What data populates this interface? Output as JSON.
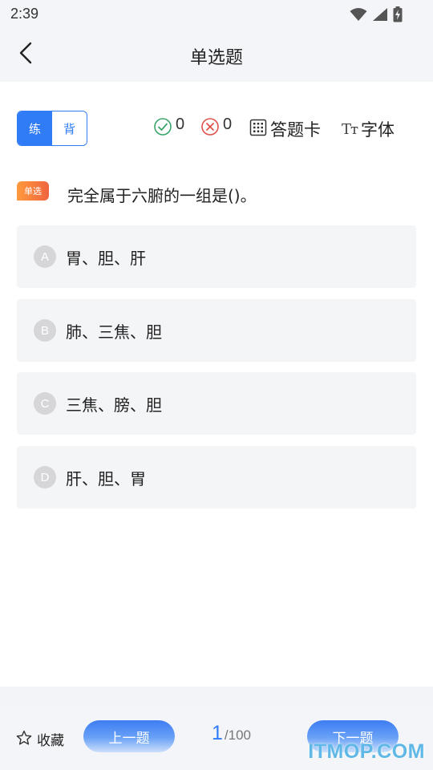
{
  "status_bar": {
    "time": "2:39",
    "icons": [
      "wifi-icon",
      "cellular-signal-icon",
      "battery-charging-icon"
    ]
  },
  "app_bar": {
    "title": "单选题",
    "back_icon": "chevron-left-icon"
  },
  "mode_toggle": {
    "practice_label": "练",
    "recite_label": "背",
    "active": "practice"
  },
  "toolbar": {
    "correct_count": "0",
    "wrong_count": "0",
    "answer_card_label": "答题卡",
    "font_glyph": "Tт",
    "font_label": "字体"
  },
  "question": {
    "type_tag": "单选",
    "text": "完全属于六腑的一组是()。",
    "options": [
      {
        "letter": "A",
        "text": "胃、胆、肝"
      },
      {
        "letter": "B",
        "text": "肺、三焦、胆"
      },
      {
        "letter": "C",
        "text": "三焦、膀、胆"
      },
      {
        "letter": "D",
        "text": "肝、胆、胃"
      }
    ]
  },
  "bottom_bar": {
    "favorite_label": "收藏",
    "prev_label": "上一题",
    "next_label": "下一题",
    "current_page": "1",
    "total_pages": "/100"
  },
  "watermark": "ITMOP.COM",
  "colors": {
    "accent": "#2f7cf6",
    "tag_orange": "#f0643f",
    "correct_green": "#3aa56b",
    "wrong_red": "#e0524a",
    "option_bg": "#f4f5f7"
  }
}
